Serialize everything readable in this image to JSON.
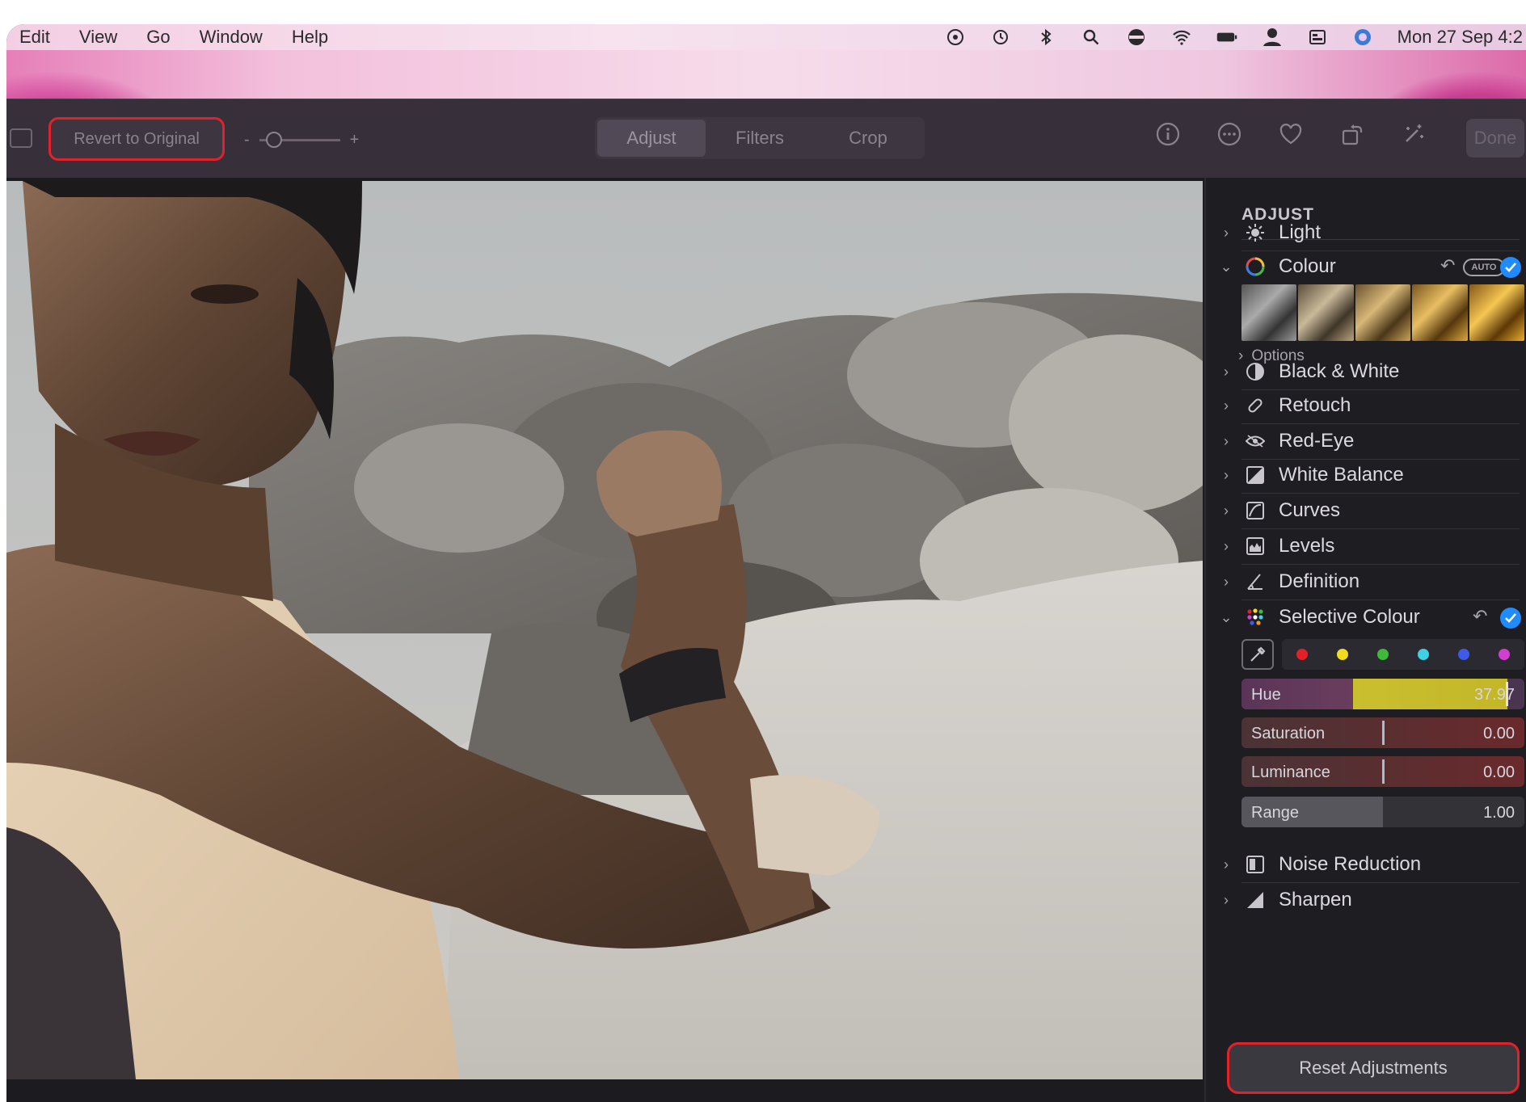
{
  "menubar": {
    "items": [
      "Edit",
      "View",
      "Go",
      "Window",
      "Help"
    ],
    "clock": "Mon 27 Sep  4:2",
    "status_icons": [
      "control-icon",
      "time-machine-icon",
      "bluetooth-icon",
      "search-icon",
      "vpn-icon",
      "wifi-icon",
      "battery-icon",
      "user-icon",
      "control-center-icon",
      "siri-icon"
    ]
  },
  "toolbar": {
    "revert_label": "Revert to Original",
    "zoom_minus": "-",
    "zoom_plus": "+",
    "zoom_level": 0.1,
    "tabs": [
      "Adjust",
      "Filters",
      "Crop"
    ],
    "active_tab": "Adjust",
    "icons": [
      "info-icon",
      "more-icon",
      "heart-icon",
      "rotate-icon",
      "enhance-icon"
    ],
    "done_label": "Done"
  },
  "panel": {
    "title": "ADJUST",
    "light": "Light",
    "colour": "Colour",
    "auto_label": "AUTO",
    "options": "Options",
    "black_white": "Black & White",
    "retouch": "Retouch",
    "red_eye": "Red-Eye",
    "white_balance": "White Balance",
    "curves": "Curves",
    "levels": "Levels",
    "definition": "Definition",
    "selective_colour": "Selective Colour",
    "swatch_colors": [
      "#e3202a",
      "#f2dc1d",
      "#3fb93c",
      "#3fd0e4",
      "#3d5be6",
      "#d23fd0"
    ],
    "sliders": {
      "hue": {
        "label": "Hue",
        "value": "37.97",
        "fill_fraction": 0.94
      },
      "saturation": {
        "label": "Saturation",
        "value": "0.00"
      },
      "luminance": {
        "label": "Luminance",
        "value": "0.00"
      },
      "range": {
        "label": "Range",
        "value": "1.00"
      }
    },
    "noise_reduction": "Noise Reduction",
    "sharpen": "Sharpen",
    "reset_label": "Reset Adjustments"
  },
  "colors": {
    "accent_highlight": "#e0222b",
    "check_blue": "#1f8bff",
    "panel_bg": "#1e1d22",
    "toolbar_bg": "#37303a"
  }
}
